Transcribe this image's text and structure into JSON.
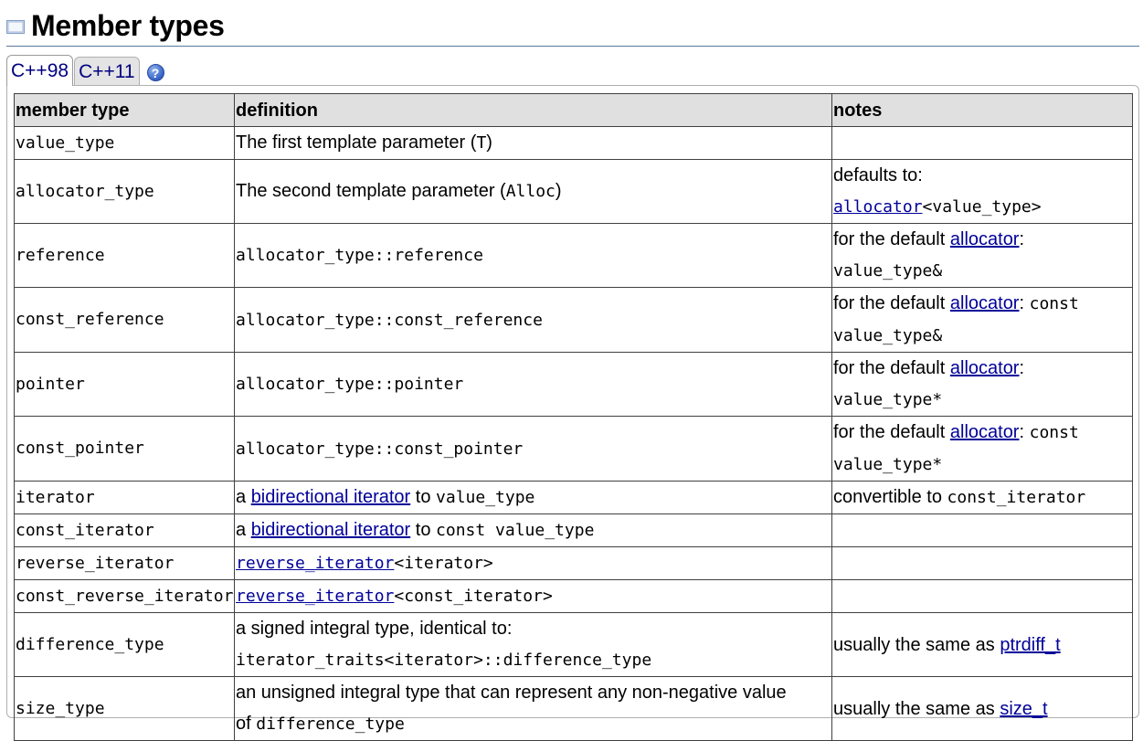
{
  "section": {
    "title": "Member types",
    "icon": "book-icon"
  },
  "tabs": [
    {
      "label": "C++98",
      "active": true
    },
    {
      "label": "C++11",
      "active": false
    }
  ],
  "help": {
    "label": "?"
  },
  "table": {
    "headers": [
      "member type",
      "definition",
      "notes"
    ],
    "rows": [
      {
        "name": "value_type",
        "def": {
          "text": "The first template parameter (",
          "code": "T",
          "after": ")"
        },
        "notes": {}
      },
      {
        "name": "allocator_type",
        "def": {
          "text": "The second template parameter (",
          "code": "Alloc",
          "after": ")"
        },
        "notes": {
          "line1": "defaults to:",
          "link": "allocator",
          "code": "<value_type>"
        }
      },
      {
        "name": "reference",
        "def": {
          "code": "allocator_type::reference"
        },
        "notes": {
          "prefix": "for the default ",
          "link": "allocator",
          "suffix": ":",
          "code": "value_type&"
        }
      },
      {
        "name": "const_reference",
        "def": {
          "code": "allocator_type::const_reference"
        },
        "notes": {
          "prefix": "for the default ",
          "link": "allocator",
          "suffix": ":",
          "code_inline": "const",
          "code": "value_type&"
        }
      },
      {
        "name": "pointer",
        "def": {
          "code": "allocator_type::pointer"
        },
        "notes": {
          "prefix": "for the default ",
          "link": "allocator",
          "suffix": ":",
          "code": "value_type*"
        }
      },
      {
        "name": "const_pointer",
        "def": {
          "code": "allocator_type::const_pointer"
        },
        "notes": {
          "prefix": "for the default ",
          "link": "allocator",
          "suffix": ":",
          "code_inline": "const",
          "code": "value_type*"
        }
      },
      {
        "name": "iterator",
        "def": {
          "prefix": "a ",
          "link": "bidirectional iterator",
          "middle": " to ",
          "code": "value_type"
        },
        "notes": {
          "text": "convertible to ",
          "code": "const_iterator"
        }
      },
      {
        "name": "const_iterator",
        "def": {
          "prefix": "a ",
          "link": "bidirectional iterator",
          "middle": " to ",
          "code": "const value_type"
        },
        "notes": {}
      },
      {
        "name": "reverse_iterator",
        "def": {
          "link": "reverse_iterator",
          "code": "<iterator>"
        },
        "notes": {}
      },
      {
        "name": "const_reverse_iterator",
        "def": {
          "link": "reverse_iterator",
          "code": "<const_iterator>"
        },
        "notes": {}
      },
      {
        "name": "difference_type",
        "def": {
          "line1": "a signed integral type, identical to:",
          "code": "iterator_traits<iterator>::difference_type"
        },
        "notes": {
          "text": "usually the same as ",
          "link": "ptrdiff_t"
        }
      },
      {
        "name": "size_type",
        "def": {
          "line1": "an unsigned integral type that can represent any non-negative value",
          "line2": "of ",
          "code": "difference_type"
        },
        "notes": {
          "text": "usually the same as ",
          "link": "size_t"
        }
      }
    ]
  }
}
